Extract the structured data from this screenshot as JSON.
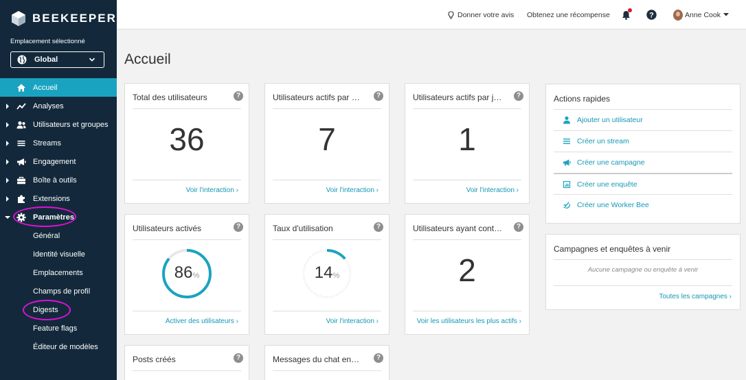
{
  "sidebar": {
    "brand": "BEEKEEPER",
    "location_label": "Emplacement sélectionné",
    "location_value": "Global",
    "nav": [
      {
        "label": "Accueil",
        "icon": "home-icon",
        "active": true,
        "arrow": false
      },
      {
        "label": "Analyses",
        "icon": "chart-line-icon",
        "arrow": true
      },
      {
        "label": "Utilisateurs et groupes",
        "icon": "users-icon",
        "arrow": true
      },
      {
        "label": "Streams",
        "icon": "list-icon",
        "arrow": true
      },
      {
        "label": "Engagement",
        "icon": "megaphone-icon",
        "arrow": true
      },
      {
        "label": "Boîte à outils",
        "icon": "toolbox-icon",
        "arrow": true
      },
      {
        "label": "Extensions",
        "icon": "puzzle-icon",
        "arrow": true
      },
      {
        "label": "Paramètres",
        "icon": "gear-icon",
        "arrow": true,
        "expanded": true
      }
    ],
    "settings_sub": [
      "Général",
      "Identité visuelle",
      "Emplacements",
      "Champs de profil",
      "Digests",
      "Feature flags",
      "Éditeur de modèles"
    ]
  },
  "topbar": {
    "feedback": "Donner votre avis",
    "reward": "Obtenez une récompense",
    "user": "Anne Cook"
  },
  "page_title": "Accueil",
  "cards": {
    "total_users": {
      "title": "Total des utilisateurs",
      "value": "36",
      "link": "Voir l'interaction ›"
    },
    "active_per_month": {
      "title": "Utilisateurs actifs par mois",
      "value": "7",
      "link": "Voir l'interaction ›"
    },
    "active_per_day": {
      "title": "Utilisateurs actifs par jour",
      "value": "1",
      "link": "Voir l'interaction ›"
    },
    "activated_users": {
      "title": "Utilisateurs activés",
      "value": "86",
      "unit": "%",
      "percent": 86,
      "link": "Activer des utilisateurs ›"
    },
    "usage_rate": {
      "title": "Taux d'utilisation",
      "value": "14",
      "unit": "%",
      "percent": 14,
      "link": "Voir l'interaction ›"
    },
    "contributing_users": {
      "title": "Utilisateurs ayant contribué",
      "value": "2",
      "link": "Voir les utilisateurs les plus actifs ›"
    },
    "posts_created": {
      "title": "Posts créés"
    },
    "chat_messages": {
      "title": "Messages du chat envoyés"
    }
  },
  "quick_actions": {
    "title": "Actions rapides",
    "items": [
      {
        "label": "Ajouter un utilisateur",
        "icon": "user-icon"
      },
      {
        "label": "Créer un stream",
        "icon": "list-icon"
      },
      {
        "label": "Créer une campagne",
        "icon": "megaphone-icon"
      },
      {
        "label": "Créer une enquête",
        "icon": "survey-icon"
      },
      {
        "label": "Créer une Worker Bee",
        "icon": "worker-bee-icon"
      }
    ]
  },
  "campaigns": {
    "title": "Campagnes et enquêtes à venir",
    "empty": "Aucune campagne ou enquête à venir",
    "link": "Toutes les campagnes ›"
  },
  "colors": {
    "sidebar": "#13293b",
    "accent": "#1aa3c0",
    "link": "#1497b4",
    "highlight": "#e010d6"
  }
}
